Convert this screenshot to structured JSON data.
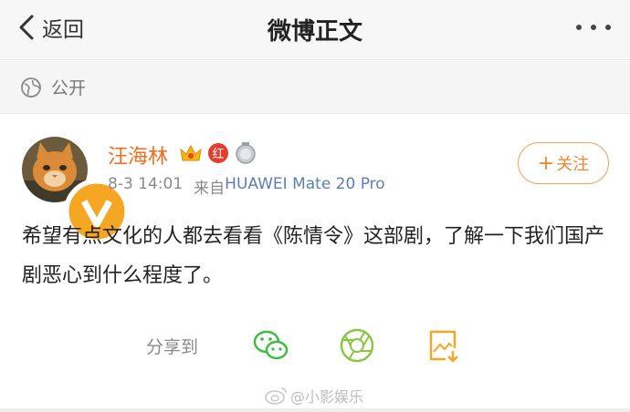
{
  "nav": {
    "back_label": "返回",
    "title": "微博正文",
    "more_icon": "more-dots-icon"
  },
  "privacy": {
    "icon": "globe-icon",
    "label": "公开"
  },
  "post": {
    "author": "汪海林",
    "badges": [
      "crown-vip-icon",
      "red-badge-icon",
      "medal-icon"
    ],
    "badge_red_text": "红",
    "date": "8-3 14:01",
    "source_prefix": "来自",
    "device": "HUAWEI Mate 20 Pro",
    "follow_label": "关注",
    "content": "希望有点文化的人都去看看《陈情令》这部剧，了解一下我们国产剧恶心到什么程度了。"
  },
  "share": {
    "label": "分享到",
    "targets": [
      "wechat-icon",
      "moments-icon",
      "save-image-icon"
    ]
  },
  "watermark": "@小影娱乐",
  "colors": {
    "accent": "#f86a17",
    "link": "#5b7fb3",
    "follow_border": "#f7a258",
    "wechat": "#3dbb3e",
    "moments": "#88c540",
    "save": "#f5a623"
  }
}
